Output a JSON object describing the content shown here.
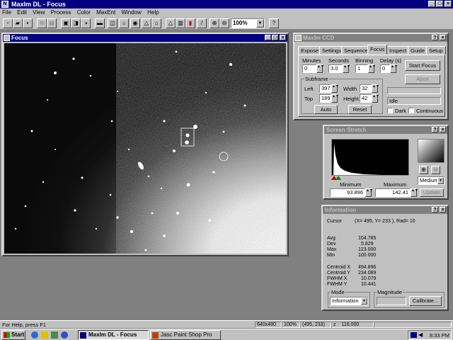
{
  "app": {
    "title": "MaxIm DL - Focus"
  },
  "menu": [
    "File",
    "Edit",
    "View",
    "Process",
    "Color",
    "MaxEnt",
    "Window",
    "Help"
  ],
  "toolbar": {
    "zoom": "100%"
  },
  "focus_window": {
    "title": "Focus"
  },
  "ccd": {
    "title": "MaxIm CCD",
    "tabs": [
      "Expose",
      "Settings",
      "Sequence",
      "Focus",
      "Inspect",
      "Guide",
      "Setup"
    ],
    "minutes_label": "Minutes",
    "minutes": "0",
    "seconds_label": "Seconds",
    "seconds": "3.0",
    "binning_label": "Binning",
    "binning": "1",
    "delay_label": "Delay (s)",
    "delay": "0",
    "subframe_label": "Subframe",
    "left_label": "Left",
    "left": "397",
    "width_label": "Width",
    "width": "32",
    "top_label": "Top",
    "top": "189",
    "height_label": "Height",
    "height": "42",
    "auto_button": "Auto",
    "reset_button": "Reset",
    "start_button": "Start Focus",
    "abort_button": "Abort",
    "status": "Idle",
    "dark_label": "Dark",
    "continuous_label": "Continuous"
  },
  "stretch": {
    "title": "Screen Stretch",
    "minimum_label": "Minimum",
    "maximum_label": "Maximum",
    "minimum": "93.896",
    "maximum": "142.41",
    "mode": "Medium",
    "update_button": "Update"
  },
  "info": {
    "title": "Information",
    "cursor_label": "Cursor",
    "cursor": "(X= 495, Y= 233 ), Rad= 10",
    "rows": [
      {
        "k": "Avg",
        "v": "104.785"
      },
      {
        "k": "Dev",
        "v": "5.829"
      },
      {
        "k": "Max",
        "v": "123.000"
      },
      {
        "k": "Min",
        "v": "100.000"
      }
    ],
    "rows2": [
      {
        "k": "Centroid X",
        "v": "494.896"
      },
      {
        "k": "Centroid Y",
        "v": "234.089"
      },
      {
        "k": "FWHM X",
        "v": "10.079"
      },
      {
        "k": "FWHM Y",
        "v": "10.441"
      }
    ],
    "mode_label": "Mode",
    "mode": "Information",
    "magnitude_label": "Magnitude",
    "calibrate_button": "Calibrate..."
  },
  "status": {
    "help": "For Help, press F1",
    "size": "640x480",
    "zoom": "100%",
    "coords": "(495, 233)",
    "value_label": "z",
    "value": "116.000"
  },
  "taskbar": {
    "start": "Start",
    "tasks": [
      "MaxIm DL - Focus",
      "Jasc Paint Shop Pro"
    ],
    "clock": "8:33 PM"
  }
}
